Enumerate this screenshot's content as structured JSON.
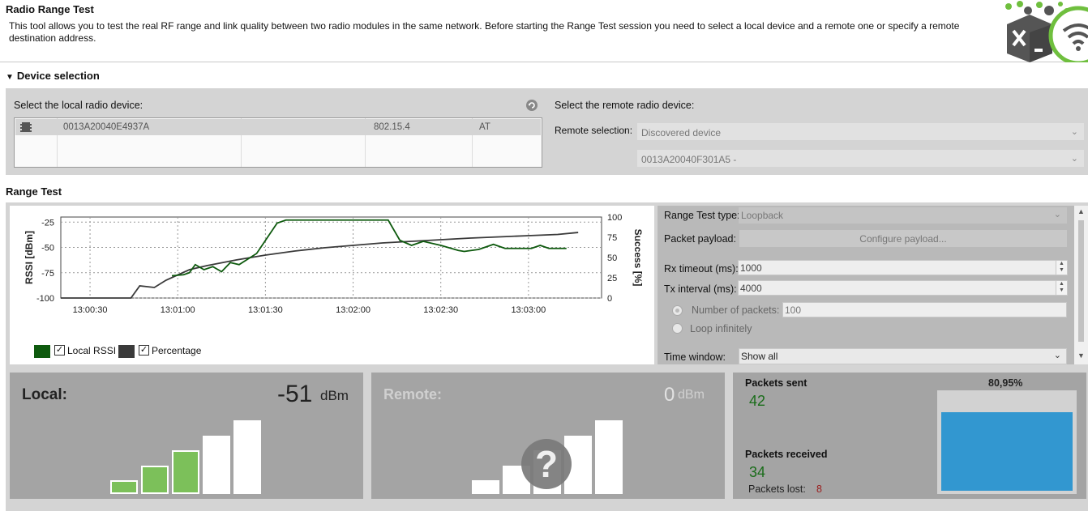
{
  "header": {
    "title": "Radio Range Test",
    "description": "This tool allows you to test the real RF range and link quality between two radio modules in the same network. Before starting the Range Test session you need to select a local device and a remote one or specify a remote destination address."
  },
  "device_selection": {
    "heading": "Device selection",
    "local_label": "Select the local radio device:",
    "remote_label": "Select the remote radio device:",
    "local_device": {
      "address": "0013A20040E4937A",
      "protocol": "802.15.4",
      "mode": "AT"
    },
    "remote_selection_label": "Remote selection:",
    "remote_selection_value": "Discovered device",
    "remote_device_value": "0013A20040F301A5 -"
  },
  "range_test": {
    "heading": "Range Test",
    "legend": [
      {
        "label": "Local RSSI",
        "color": "#0e5a0e",
        "checked": true
      },
      {
        "label": "Percentage",
        "color": "#3a3a3a",
        "checked": true
      }
    ],
    "config": {
      "type_label": "Range Test type:",
      "type_value": "Loopback",
      "payload_label": "Packet payload:",
      "payload_button": "Configure payload...",
      "rx_label": "Rx timeout (ms):",
      "rx_value": "1000",
      "tx_label": "Tx interval (ms):",
      "tx_value": "4000",
      "num_packets_label": "Number of packets:",
      "num_packets_value": "100",
      "loop_label": "Loop infinitely",
      "time_window_label": "Time window:",
      "time_window_value": "Show all"
    }
  },
  "chart_data": {
    "type": "line",
    "ylabel": "RSSI [dBm]",
    "y2label": "Success [%]",
    "ylim": [
      -100,
      -20
    ],
    "y_ticks": [
      "-25",
      "-50",
      "-75",
      "-100"
    ],
    "y2lim": [
      0,
      100
    ],
    "y2_ticks": [
      "100",
      "75",
      "50",
      "25",
      "0"
    ],
    "x_ticks": [
      "13:00:30",
      "13:01:00",
      "13:01:30",
      "13:02:00",
      "13:02:30",
      "13:03:00"
    ],
    "grid": true,
    "series": [
      {
        "name": "Local RSSI",
        "color": "#0e5a0e",
        "points": [
          [
            "13:00:58",
            -78
          ],
          [
            "13:01:02",
            -77
          ],
          [
            "13:01:04",
            -75
          ],
          [
            "13:01:06",
            -67
          ],
          [
            "13:01:09",
            -72
          ],
          [
            "13:01:12",
            -69
          ],
          [
            "13:01:15",
            -74
          ],
          [
            "13:01:18",
            -65
          ],
          [
            "13:01:21",
            -67
          ],
          [
            "13:01:27",
            -56
          ],
          [
            "13:01:34",
            -26
          ],
          [
            "13:01:37",
            -23
          ],
          [
            "13:02:12",
            -23
          ],
          [
            "13:02:16",
            -43
          ],
          [
            "13:02:20",
            -48
          ],
          [
            "13:02:24",
            -44
          ],
          [
            "13:02:30",
            -48
          ],
          [
            "13:02:36",
            -53
          ],
          [
            "13:02:38",
            -54
          ],
          [
            "13:02:43",
            -52
          ],
          [
            "13:02:48",
            -47
          ],
          [
            "13:02:52",
            -51
          ],
          [
            "13:03:01",
            -51
          ],
          [
            "13:03:04",
            -48
          ],
          [
            "13:03:07",
            -51
          ],
          [
            "13:03:13",
            -51
          ]
        ]
      },
      {
        "name": "Percentage",
        "color": "#3a3a3a",
        "points": [
          [
            "13:00:20",
            0
          ],
          [
            "13:00:44",
            0
          ],
          [
            "13:00:47",
            15
          ],
          [
            "13:00:52",
            13
          ],
          [
            "13:00:56",
            22
          ],
          [
            "13:01:04",
            35
          ],
          [
            "13:01:10",
            40
          ],
          [
            "13:01:20",
            47
          ],
          [
            "13:01:30",
            53
          ],
          [
            "13:01:40",
            58
          ],
          [
            "13:01:50",
            62
          ],
          [
            "13:02:00",
            65
          ],
          [
            "13:02:10",
            68
          ],
          [
            "13:02:20",
            70
          ],
          [
            "13:02:30",
            72
          ],
          [
            "13:02:40",
            74
          ],
          [
            "13:02:50",
            75.5
          ],
          [
            "13:03:00",
            77
          ],
          [
            "13:03:10",
            78.5
          ],
          [
            "13:03:17",
            80.95
          ]
        ]
      }
    ]
  },
  "meters": {
    "local": {
      "title": "Local:",
      "value": "-51",
      "unit": "dBm",
      "signal_level": 3,
      "max_level": 5
    },
    "remote": {
      "title": "Remote:",
      "value": "0",
      "unit": "dBm",
      "signal_level": 0,
      "max_level": 5,
      "unknown_glyph": "?"
    }
  },
  "stats": {
    "sent_label": "Packets sent",
    "sent_value": "42",
    "received_label": "Packets received",
    "received_value": "34",
    "lost_label": "Packets lost:",
    "lost_value": "8",
    "percent_label": "80,95%",
    "percent": 80.95
  }
}
